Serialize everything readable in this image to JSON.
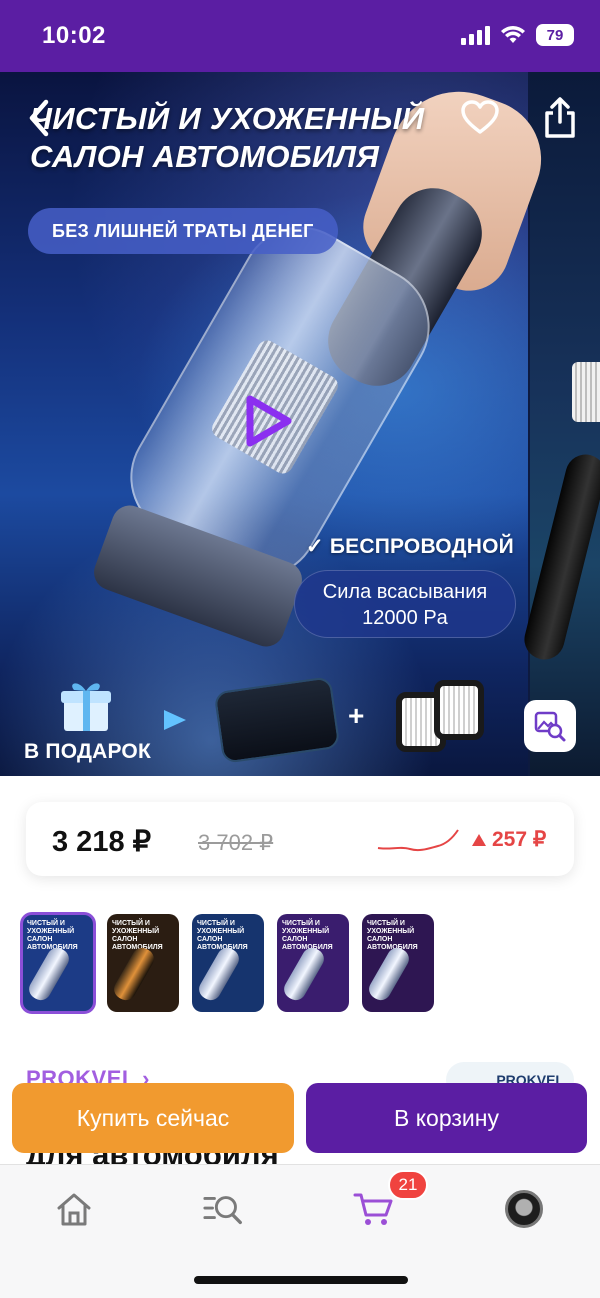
{
  "status_bar": {
    "time": "10:02",
    "battery": "79"
  },
  "hero": {
    "title_line1": "ЧИСТЫЙ И УХОЖЕННЫЙ",
    "title_line2": "САЛОН АВТОМОБИЛЯ",
    "pill": "БЕЗ ЛИШНЕЙ ТРАТЫ ДЕНЕГ",
    "wireless": "✓ БЕСПРОВОДНОЙ",
    "suction_line1": "Сила всасывания",
    "suction_line2": "12000 Pa",
    "gift_label": "В ПОДАРОК",
    "plus": "+"
  },
  "price": {
    "current": "3 218 ₽",
    "old": "3 702 ₽",
    "change": "257 ₽",
    "change_color": "#e54545"
  },
  "thumbnails": [
    {
      "title": "ЧИСТЫЙ И УХОЖЕННЫЙ САЛОН АВТОМОБИЛЯ",
      "bg": "#1c3b86",
      "selected": true
    },
    {
      "title": "ЧИСТЫЙ И УХОЖЕННЫЙ САЛОН АВТОМОБИЛЯ",
      "bg": "#2b1d12",
      "selected": false
    },
    {
      "title": "ЧИСТЫЙ И УХОЖЕННЫЙ САЛОН АВТОМОБИЛЯ",
      "bg": "#16346e",
      "selected": false
    },
    {
      "title": "ЧИСТЫЙ И УХОЖЕННЫЙ САЛОН АВТОМОБИЛЯ",
      "bg": "#3a1d6e",
      "selected": false
    },
    {
      "title": "ЧИСТЫЙ И УХОЖЕННЫЙ САЛОН АВТОМОБИЛЯ",
      "bg": "#2e1652",
      "selected": false
    }
  ],
  "seller": {
    "name": "PROKVEL ›",
    "logo_text": "PROKVEL"
  },
  "product": {
    "title_visible": "для автомобиля"
  },
  "actions": {
    "buy_now": "Купить сейчас",
    "add_to_cart": "В корзину"
  },
  "tabbar": {
    "cart_count": "21",
    "icons": [
      "home-icon",
      "catalog-search-icon",
      "cart-icon",
      "profile-avatar"
    ]
  },
  "colors": {
    "brand": "#5b1ea3",
    "accent_orange": "#f19a2f",
    "link_purple": "#a25ee0",
    "sale_red": "#e54545"
  }
}
